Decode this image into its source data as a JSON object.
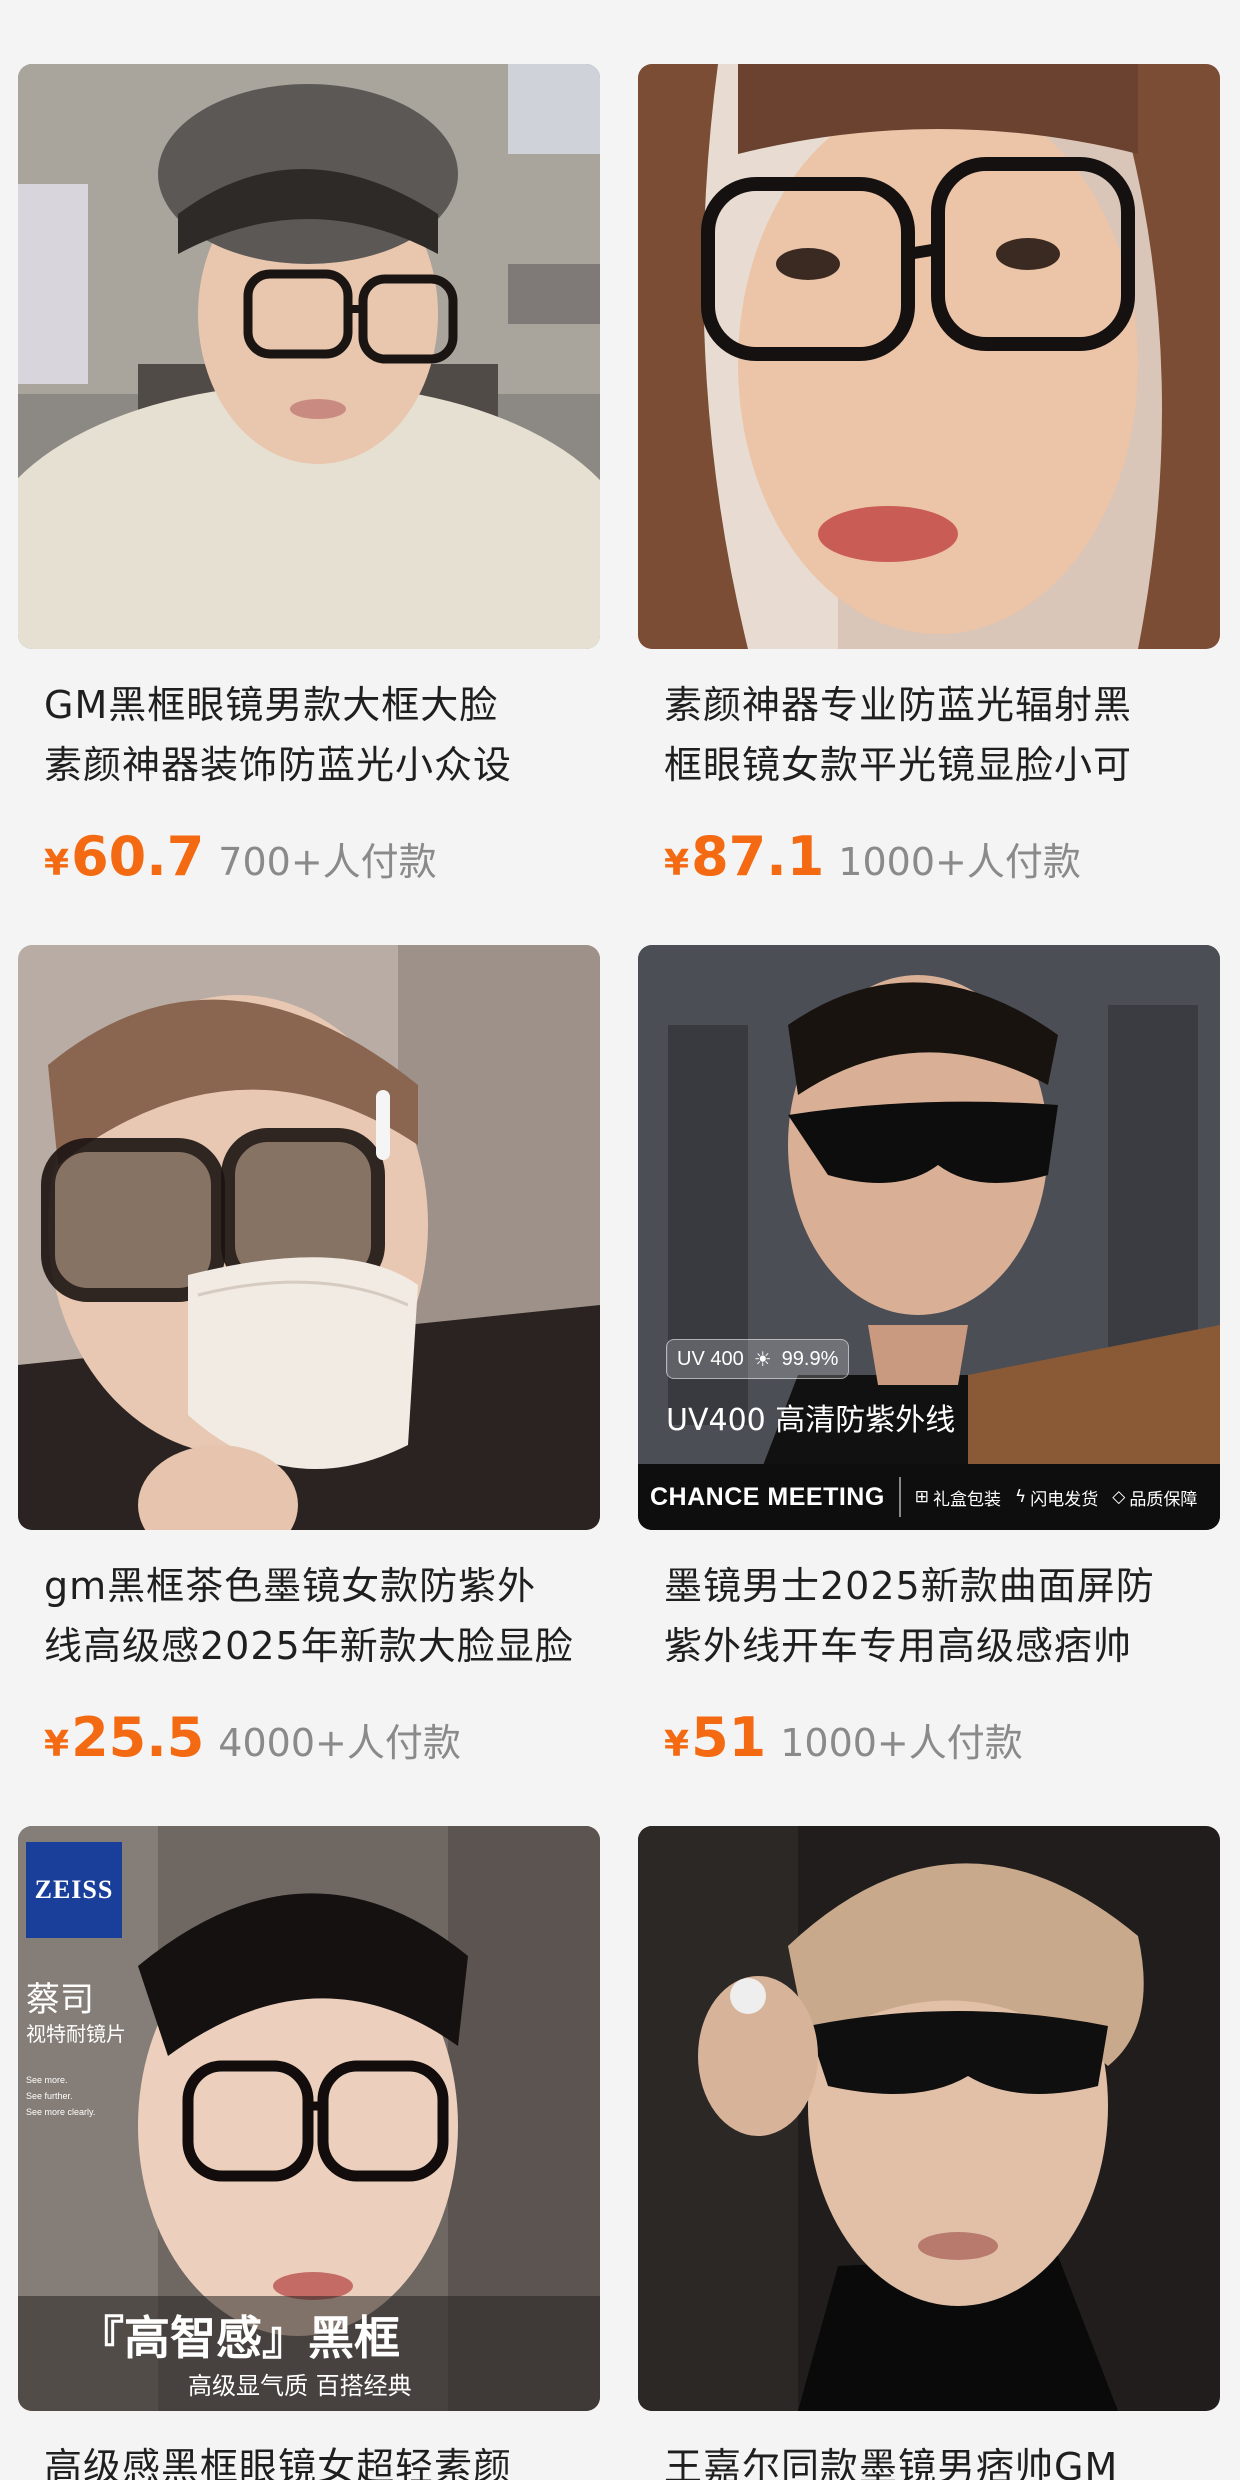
{
  "products": [
    {
      "title_line1": "GM黑框眼镜男款大框大脸",
      "title_line2": "素颜神器装饰防蓝光小众设",
      "currency": "¥",
      "price": "60.7",
      "sold": "700+人付款"
    },
    {
      "title_line1": "素颜神器专业防蓝光辐射黑",
      "title_line2": "框眼镜女款平光镜显脸小可",
      "currency": "¥",
      "price": "87.1",
      "sold": "1000+人付款"
    },
    {
      "title_line1": "gm黑框茶色墨镜女款防紫外",
      "title_line2": "线高级感2025年新款大脸显脸",
      "currency": "¥",
      "price": "25.5",
      "sold": "4000+人付款"
    },
    {
      "title_line1": "墨镜男士2025新款曲面屏防",
      "title_line2": "紫外线开车专用高级感痞帅",
      "currency": "¥",
      "price": "51",
      "sold": "1000+人付款",
      "overlay": {
        "uv_chip": "UV 400",
        "uv_percent": "99.9%",
        "headline": "UV400 高清防紫外线",
        "brand": "CHANCE MEETING",
        "features": [
          "礼盒包装",
          "闪电发货",
          "品质保障"
        ]
      }
    },
    {
      "title_line1": "高级感黑框眼镜女超轻素颜",
      "overlay": {
        "logo": "ZEISS",
        "brand_cn": "蔡司",
        "sub": "视特耐镜片",
        "tagline": [
          "See more.",
          "See further.",
          "See more clearly."
        ],
        "banner": "『高智感』黑框",
        "banner_sub": "高级显气质 百搭经典"
      }
    },
    {
      "title_line1": "王嘉尔同款墨镜男痞帅GM"
    }
  ],
  "colors": {
    "price": "#f36a12",
    "sold": "#8a8a8a",
    "zeiss_blue": "#1a3f9b"
  }
}
